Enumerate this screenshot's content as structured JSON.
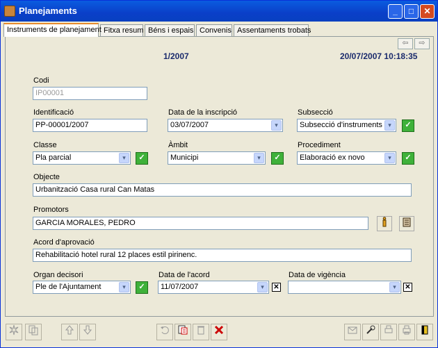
{
  "window": {
    "title": "Planejaments"
  },
  "tabs": [
    {
      "label": "Instruments de planejament"
    },
    {
      "label": "Fitxa resum"
    },
    {
      "label": "Béns i espais"
    },
    {
      "label": "Convenis"
    },
    {
      "label": "Assentaments trobats"
    }
  ],
  "header": {
    "number": "1/2007",
    "datetime": "20/07/2007 10:18:35"
  },
  "form": {
    "codi": {
      "label": "Codi",
      "value": "IP00001"
    },
    "identificacio": {
      "label": "Identificació",
      "value": "PP-00001/2007"
    },
    "data_inscripcio": {
      "label": "Data de la inscripció",
      "value": "03/07/2007"
    },
    "subseccio": {
      "label": "Subsecció",
      "value": "Subsecció d'instruments d"
    },
    "classe": {
      "label": "Classe",
      "value": "Pla parcial"
    },
    "ambit": {
      "label": "Àmbit",
      "value": "Municipi"
    },
    "procediment": {
      "label": "Procediment",
      "value": "Elaboració ex novo"
    },
    "objecte": {
      "label": "Objecte",
      "value": "Urbanització Casa rural Can Matas"
    },
    "promotors": {
      "label": "Promotors",
      "value": "GARCIA MORALES, PEDRO"
    },
    "acord": {
      "label": "Acord d'aprovació",
      "value": "Rehabilitació hotel rural 12 places estil pirinenc."
    },
    "organ": {
      "label": "Organ decisori",
      "value": "Ple de l'Ajuntament"
    },
    "data_acord": {
      "label": "Data de l'acord",
      "value": "11/07/2007"
    },
    "data_vigencia": {
      "label": "Data de vigència",
      "value": ""
    }
  },
  "glyphs": {
    "dropdown": "▾",
    "check": "✓",
    "x": "✕",
    "nav_prev": "⇦",
    "nav_next": "⇨",
    "min": "_",
    "max": "□",
    "close": "✕"
  }
}
